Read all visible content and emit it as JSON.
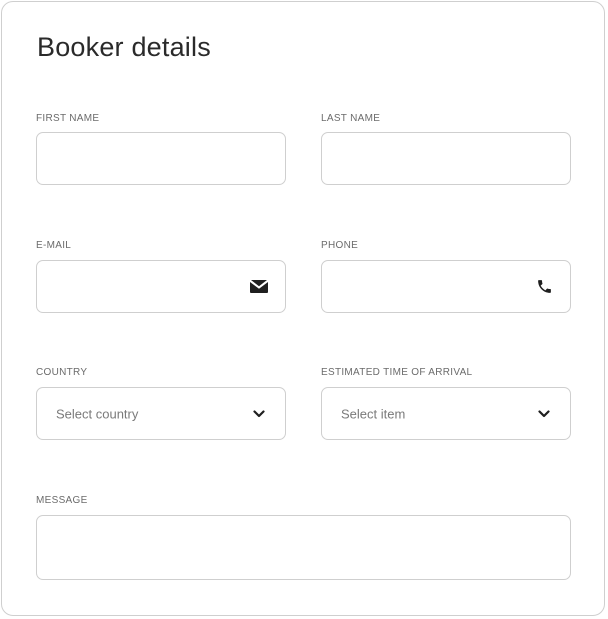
{
  "form": {
    "title": "Booker details",
    "first_name": {
      "label": "FIRST NAME",
      "value": ""
    },
    "last_name": {
      "label": "LAST NAME",
      "value": ""
    },
    "email": {
      "label": "E-MAIL",
      "value": "",
      "icon": "envelope-icon"
    },
    "phone": {
      "label": "PHONE",
      "value": "",
      "icon": "phone-icon"
    },
    "country": {
      "label": "COUNTRY",
      "selected": "Select country",
      "icon": "chevron-down-icon"
    },
    "arrival": {
      "label": "ESTIMATED TIME OF ARRIVAL",
      "selected": "Select item",
      "icon": "chevron-down-icon"
    },
    "message": {
      "label": "MESSAGE",
      "value": ""
    }
  }
}
